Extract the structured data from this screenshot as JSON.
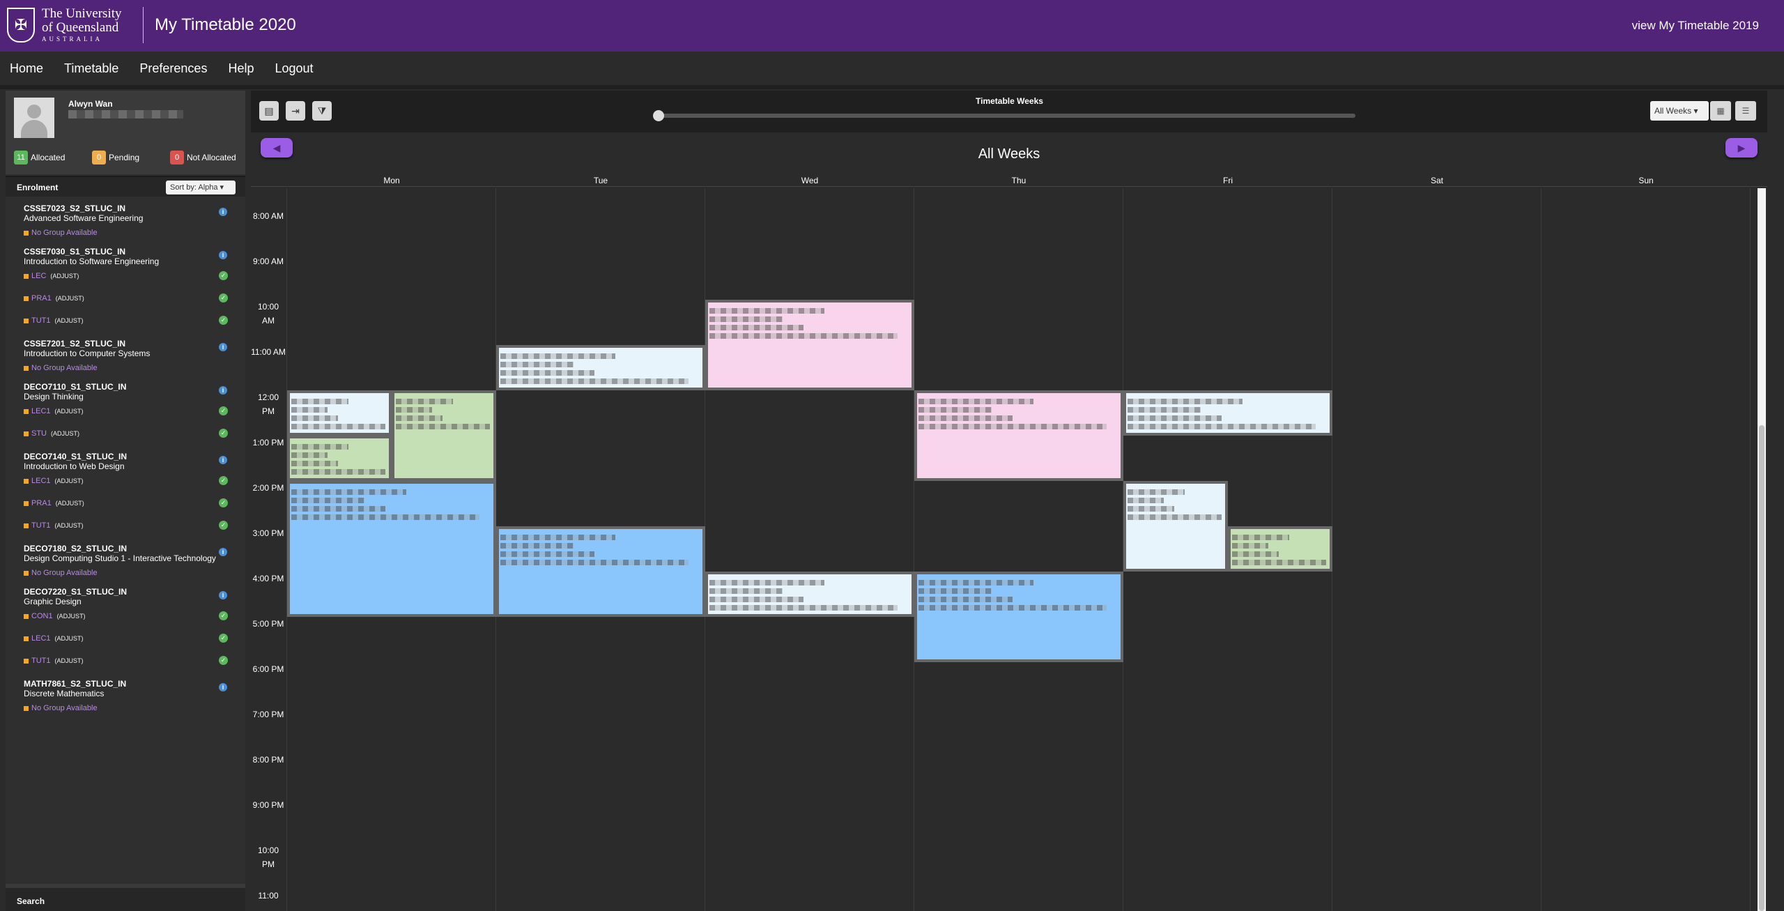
{
  "header": {
    "logo_line1": "The University",
    "logo_line2": "of Queensland",
    "logo_line3": "AUSTRALIA",
    "app_title": "My Timetable 2020",
    "prev_link": "view My Timetable 2019"
  },
  "nav": {
    "items": [
      "Home",
      "Timetable",
      "Preferences",
      "Help",
      "Logout"
    ]
  },
  "profile": {
    "name": "Alwyn Wan",
    "allocated_count": "11",
    "allocated_label": "Allocated",
    "pending_count": "0",
    "pending_label": "Pending",
    "not_allocated_count": "0",
    "not_allocated_label": "Not Allocated"
  },
  "enrolment": {
    "title": "Enrolment",
    "sort_label": "Sort by: Alpha",
    "no_group": "No Group Available",
    "adjust": "(ADJUST)",
    "courses": [
      {
        "code": "CSSE7023_S2_STLUC_IN",
        "name": "Advanced Software Engineering",
        "groups": []
      },
      {
        "code": "CSSE7030_S1_STLUC_IN",
        "name": "Introduction to Software Engineering",
        "groups": [
          "LEC",
          "PRA1",
          "TUT1"
        ]
      },
      {
        "code": "CSSE7201_S2_STLUC_IN",
        "name": "Introduction to Computer Systems",
        "groups": []
      },
      {
        "code": "DECO7110_S1_STLUC_IN",
        "name": "Design Thinking",
        "groups": [
          "LEC1",
          "STU"
        ]
      },
      {
        "code": "DECO7140_S1_STLUC_IN",
        "name": "Introduction to Web Design",
        "groups": [
          "LEC1",
          "PRA1",
          "TUT1"
        ]
      },
      {
        "code": "DECO7180_S2_STLUC_IN",
        "name": "Design Computing Studio 1 - Interactive Technology",
        "groups": []
      },
      {
        "code": "DECO7220_S1_STLUC_IN",
        "name": "Graphic Design",
        "groups": [
          "CON1",
          "LEC1",
          "TUT1"
        ]
      },
      {
        "code": "MATH7861_S2_STLUC_IN",
        "name": "Discrete Mathematics",
        "groups": []
      }
    ]
  },
  "search": {
    "label": "Search"
  },
  "toolbar": {
    "weeks_title": "Timetable Weeks",
    "week_select": "All Weeks",
    "week_heading": "All Weeks"
  },
  "days": [
    "Mon",
    "Tue",
    "Wed",
    "Thu",
    "Fri",
    "Sat",
    "Sun"
  ],
  "times": [
    "8:00 AM",
    "9:00 AM",
    "10:00 AM",
    "11:00 AM",
    "12:00 PM",
    "1:00 PM",
    "2:00 PM",
    "3:00 PM",
    "4:00 PM",
    "5:00 PM",
    "6:00 PM",
    "7:00 PM",
    "8:00 PM",
    "9:00 PM",
    "10:00 PM",
    "11:00"
  ],
  "colors": {
    "brand": "#51247a",
    "pill": "#9b5de5",
    "event_pink": "#f8d5ec",
    "event_lightblue": "#e8f4fc",
    "event_green": "#c5e0b4",
    "event_blue": "#8ac6fb"
  }
}
